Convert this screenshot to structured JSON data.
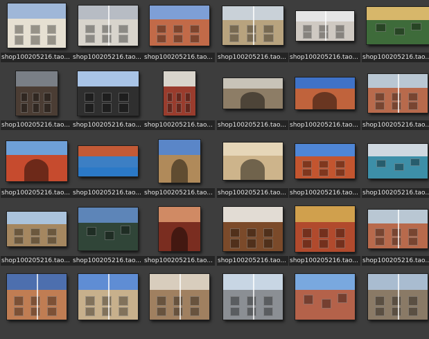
{
  "grid": {
    "items": [
      {
        "caption": "shop100205216.tao...",
        "sky": "#9fb7d8",
        "wall": "#e6e0d2",
        "split": false,
        "style": "building"
      },
      {
        "caption": "shop100205216.tao...",
        "sky": "#b7bcc4",
        "wall": "#d8d4cc",
        "split": true,
        "style": "building"
      },
      {
        "caption": "shop100205216.tao...",
        "sky": "#7e9fd6",
        "wall": "#c26a48",
        "split": false,
        "style": "building"
      },
      {
        "caption": "shop100205216.tao...",
        "sky": "#c9d1d8",
        "wall": "#b8a37e",
        "split": true,
        "style": "building"
      },
      {
        "caption": "shop100205216.tao...",
        "sky": "#e5e5e5",
        "wall": "#cfc9c2",
        "split": true,
        "style": "building"
      },
      {
        "caption": "shop100205216.tao...",
        "sky": "#d7b76a",
        "wall": "#3e6b3a",
        "split": false,
        "style": "mural"
      },
      {
        "caption": "shop100205216.tao...",
        "sky": "#7a7f86",
        "wall": "#4b3d34",
        "split": false,
        "style": "building"
      },
      {
        "caption": "shop100205216.tao...",
        "sky": "#a9c4e6",
        "wall": "#2f2f2f",
        "split": false,
        "style": "building"
      },
      {
        "caption": "shop100205216.tao...",
        "sky": "#d9d5cc",
        "wall": "#9a3c2d",
        "split": false,
        "style": "building"
      },
      {
        "caption": "shop100205216.tao...",
        "sky": "#c8c3b8",
        "wall": "#8d7d66",
        "split": false,
        "style": "arch"
      },
      {
        "caption": "shop100205216.tao...",
        "sky": "#3f72c7",
        "wall": "#c0633c",
        "split": false,
        "style": "arch"
      },
      {
        "caption": "shop100205216.tao...",
        "sky": "#b9c7d3",
        "wall": "#b86a4c",
        "split": true,
        "style": "building"
      },
      {
        "caption": "shop100205216.tao...",
        "sky": "#6ea0d8",
        "wall": "#c64b2e",
        "split": false,
        "style": "arch"
      },
      {
        "caption": "shop100205216.tao...",
        "sky": "#c35a36",
        "wall": "#3c7fc4",
        "split": false,
        "style": "pool"
      },
      {
        "caption": "shop100205216.tao...",
        "sky": "#5a86c8",
        "wall": "#b08a5a",
        "split": false,
        "style": "arch"
      },
      {
        "caption": "shop100205216.tao...",
        "sky": "#e6d6b8",
        "wall": "#cdb48b",
        "split": false,
        "style": "arch"
      },
      {
        "caption": "shop100205216.tao...",
        "sky": "#4f86d6",
        "wall": "#c3552f",
        "split": false,
        "style": "building"
      },
      {
        "caption": "shop100205216.tao...",
        "sky": "#cfd8e0",
        "wall": "#3d8fa8",
        "split": false,
        "style": "mural"
      },
      {
        "caption": "shop100205216.tao...",
        "sky": "#aac3dc",
        "wall": "#a58760",
        "split": false,
        "style": "building"
      },
      {
        "caption": "shop100205216.tao...",
        "sky": "#5d85b8",
        "wall": "#304538",
        "split": false,
        "style": "mural"
      },
      {
        "caption": "shop100205216.tao...",
        "sky": "#d08a64",
        "wall": "#7a2d20",
        "split": false,
        "style": "arch"
      },
      {
        "caption": "shop100205216.tao...",
        "sky": "#e2dcd4",
        "wall": "#7b4a2a",
        "split": false,
        "style": "building"
      },
      {
        "caption": "shop100205216.tao...",
        "sky": "#d0a04d",
        "wall": "#b14a2d",
        "split": false,
        "style": "building"
      },
      {
        "caption": "shop100205216.tao...",
        "sky": "#b9c7d3",
        "wall": "#b86a4c",
        "split": true,
        "style": "building"
      },
      {
        "caption": "",
        "sky": "#4d6fae",
        "wall": "#c07d53",
        "split": true,
        "style": "building"
      },
      {
        "caption": "",
        "sky": "#5f8dd4",
        "wall": "#c7b08c",
        "split": true,
        "style": "building"
      },
      {
        "caption": "",
        "sky": "#d8cdbd",
        "wall": "#a08060",
        "split": true,
        "style": "building"
      },
      {
        "caption": "",
        "sky": "#c8d6e4",
        "wall": "#8b8f94",
        "split": true,
        "style": "building"
      },
      {
        "caption": "",
        "sky": "#79a8df",
        "wall": "#b4624a",
        "split": false,
        "style": "mural"
      },
      {
        "caption": "",
        "sky": "#a9bcd0",
        "wall": "#8a7a66",
        "split": true,
        "style": "building"
      }
    ]
  }
}
